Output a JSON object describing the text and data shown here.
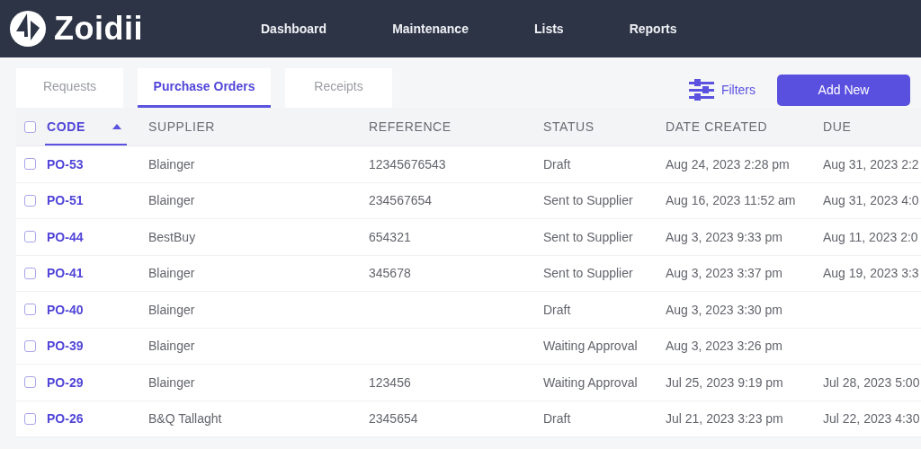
{
  "app": {
    "brand": "Zoidii"
  },
  "nav": [
    {
      "label": "Dashboard"
    },
    {
      "label": "Maintenance"
    },
    {
      "label": "Lists"
    },
    {
      "label": "Reports"
    }
  ],
  "tabs": [
    {
      "label": "Requests",
      "selected": false
    },
    {
      "label": "Purchase Orders",
      "selected": true
    },
    {
      "label": "Receipts",
      "selected": false
    }
  ],
  "filters_button": {
    "label": "Filters"
  },
  "add_button": {
    "label": "Add New"
  },
  "table": {
    "select_all_checked": false,
    "columns": [
      {
        "label": "CODE",
        "sorted": true
      },
      {
        "label": "SUPPLIER",
        "sorted": false
      },
      {
        "label": "REFERENCE",
        "sorted": false
      },
      {
        "label": "STATUS",
        "sorted": false
      },
      {
        "label": "DATE CREATED",
        "sorted": false
      },
      {
        "label": "DUE",
        "sorted": false
      }
    ],
    "rows": [
      {
        "checked": false,
        "cells": [
          "PO-53",
          "Blainger",
          "12345676543",
          "Draft",
          "Aug 24, 2023 2:28 pm",
          "Aug 31, 2023 2:2"
        ]
      },
      {
        "checked": false,
        "cells": [
          "PO-51",
          "Blainger",
          "234567654",
          "Sent to Supplier",
          "Aug 16, 2023 11:52 am",
          "Aug 31, 2023 4:0"
        ]
      },
      {
        "checked": false,
        "cells": [
          "PO-44",
          "BestBuy",
          "654321",
          "Sent to Supplier",
          "Aug 3, 2023 9:33 pm",
          "Aug 11, 2023 2:0"
        ]
      },
      {
        "checked": false,
        "cells": [
          "PO-41",
          "Blainger",
          "345678",
          "Sent to Supplier",
          "Aug 3, 2023 3:37 pm",
          "Aug 19, 2023 3:3"
        ]
      },
      {
        "checked": false,
        "cells": [
          "PO-40",
          "Blainger",
          "",
          "Draft",
          "Aug 3, 2023 3:30 pm",
          ""
        ]
      },
      {
        "checked": false,
        "cells": [
          "PO-39",
          "Blainger",
          "",
          "Waiting Approval",
          "Aug 3, 2023 3:26 pm",
          ""
        ]
      },
      {
        "checked": false,
        "cells": [
          "PO-29",
          "Blainger",
          "123456",
          "Waiting Approval",
          "Jul 25, 2023 9:19 pm",
          "Jul 28, 2023 5:00"
        ]
      },
      {
        "checked": false,
        "cells": [
          "PO-26",
          "B&Q Tallaght",
          "2345654",
          "Draft",
          "Jul 21, 2023 3:23 pm",
          "Jul 22, 2023 4:30"
        ]
      }
    ]
  }
}
